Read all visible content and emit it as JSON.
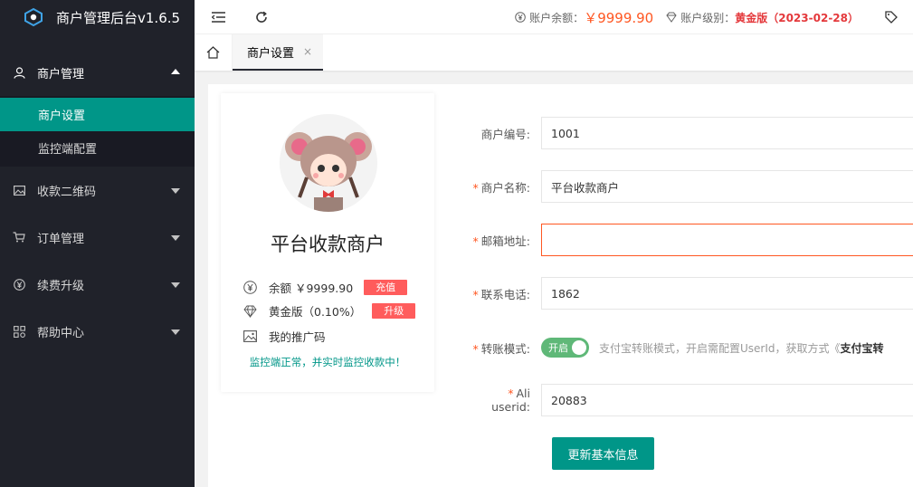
{
  "app": {
    "title": "商户管理后台v1.6.5"
  },
  "sidebar": {
    "groups": [
      {
        "label": "商户管理",
        "icon": "user-icon",
        "open": true,
        "items": [
          {
            "label": "商户设置",
            "active": true
          },
          {
            "label": "监控端配置",
            "active": false
          }
        ]
      },
      {
        "label": "收款二维码",
        "icon": "image-icon"
      },
      {
        "label": "订单管理",
        "icon": "cart-icon"
      },
      {
        "label": "续费升级",
        "icon": "yen-circle-icon"
      },
      {
        "label": "帮助中心",
        "icon": "grid-icon"
      }
    ]
  },
  "header": {
    "balance_label": "账户余额：",
    "balance_value": "￥9999.90",
    "level_label": "账户级别：",
    "level_value": "黄金版（2023-02-28）"
  },
  "tabs": {
    "active": "商户设置",
    "close": "×"
  },
  "profile": {
    "name": "平台收款商户",
    "balance_label": "余额 ￥9999.90",
    "recharge_btn": "充值",
    "level_label": "黄金版（0.10%）",
    "upgrade_btn": "升级",
    "promo_label": "我的推广码",
    "monitor_status": "监控端正常，并实时监控收款中！"
  },
  "form": {
    "merchant_id_label": "商户编号:",
    "merchant_id_value": "1001",
    "merchant_name_label": "商户名称:",
    "merchant_name_value": "平台收款商户",
    "email_label": "邮箱地址:",
    "email_value": "",
    "phone_label": "联系电话:",
    "phone_value": "1862",
    "transfer_label": "转账模式:",
    "transfer_switch": "开启",
    "transfer_tip": "支付宝转账模式，开启需配置UserId，获取方式《",
    "transfer_tip_bold": "支付宝转",
    "aliuserid_label": "Ali userid:",
    "aliuserid_value": "20883",
    "submit": "更新基本信息"
  },
  "colors": {
    "accent": "#009688",
    "sidebar_bg": "#20222a",
    "danger": "#ff5722",
    "switch_on": "#5fb878"
  }
}
